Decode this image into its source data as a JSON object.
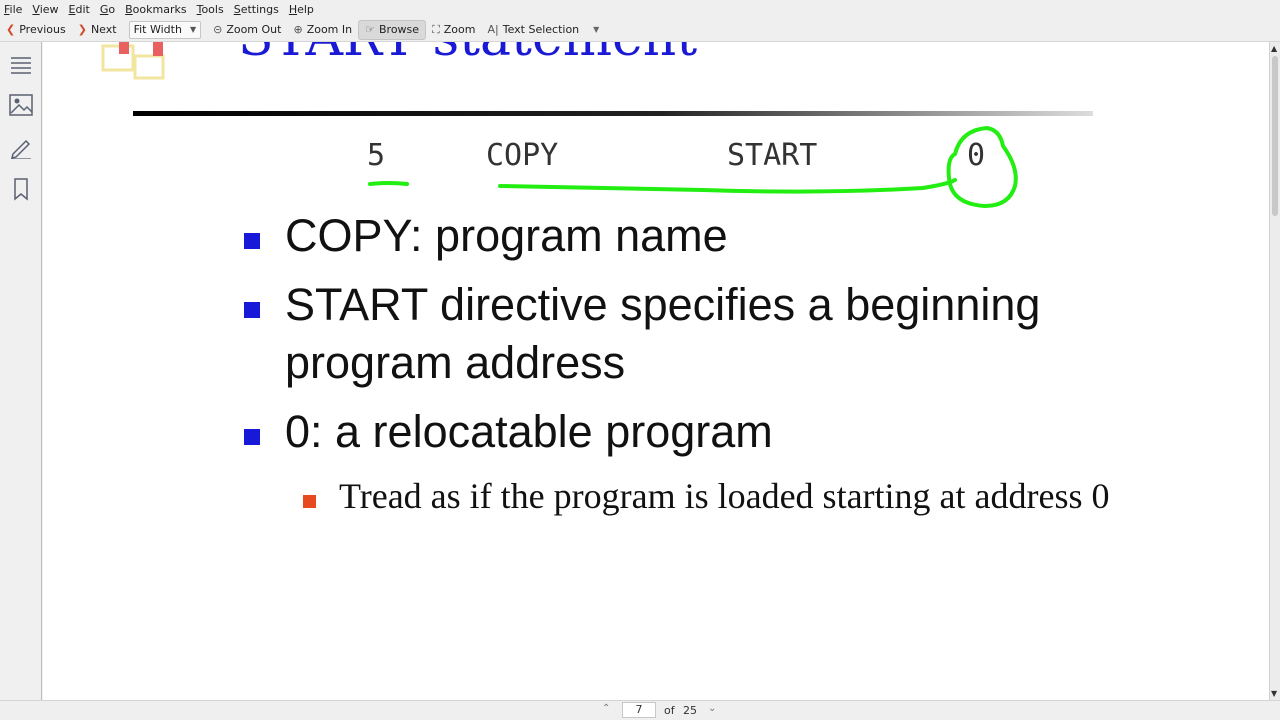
{
  "menubar": {
    "items": [
      "File",
      "View",
      "Edit",
      "Go",
      "Bookmarks",
      "Tools",
      "Settings",
      "Help"
    ]
  },
  "toolbar": {
    "previous_label": "Previous",
    "next_label": "Next",
    "zoom_mode": "Fit Width",
    "zoom_out_label": "Zoom Out",
    "zoom_in_label": "Zoom In",
    "browse_label": "Browse",
    "zoom_label": "Zoom",
    "text_selection_label": "Text Selection"
  },
  "slide": {
    "title": "START statement",
    "code_line": {
      "line_number": "5",
      "label": "COPY",
      "opcode": "START",
      "operand": "0"
    },
    "bullets": [
      {
        "text": "COPY: program name"
      },
      {
        "text_line1": "START directive specifies a beginning",
        "text_line2": "program address"
      },
      {
        "text": "0: a relocatable program"
      }
    ],
    "sub_bullets": [
      {
        "text": "Tread as if the program is loaded starting at address 0"
      }
    ]
  },
  "pagebar": {
    "current_page": "7",
    "of_label": "of",
    "total_pages": "25"
  },
  "colors": {
    "title_blue": "#1a1ad6",
    "bullet_blue": "#1818d8",
    "sub_bullet_orange": "#e64a1e",
    "ink_green": "#22ee11"
  }
}
